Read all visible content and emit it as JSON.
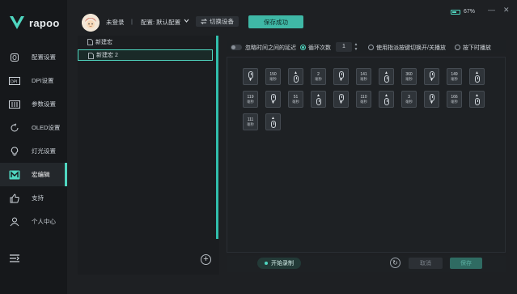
{
  "brand": {
    "logo_text": "rapoo",
    "accent": "#4fd6c0"
  },
  "sidebar": {
    "items": [
      {
        "label": "配置设置",
        "icon": "mouse-icon"
      },
      {
        "label": "DPI设置",
        "icon": "dpi-icon"
      },
      {
        "label": "参数设置",
        "icon": "sliders-icon"
      },
      {
        "label": "OLED设置",
        "icon": "oled-icon"
      },
      {
        "label": "灯光设置",
        "icon": "bulb-icon"
      },
      {
        "label": "宏编辑",
        "icon": "macro-icon",
        "active": true
      },
      {
        "label": "支持",
        "icon": "thumbs-up-icon"
      },
      {
        "label": "个人中心",
        "icon": "person-icon"
      }
    ]
  },
  "header": {
    "login_status": "未登录",
    "separator": "|",
    "profile_label": "配置: 默认配置",
    "switch_device": "切换设备",
    "save_status": "保存成功"
  },
  "battery": {
    "percent_text": "67%",
    "level": 0.67
  },
  "window_controls": {
    "minimize": "—",
    "close": "✕"
  },
  "macro_list": {
    "items": [
      {
        "label": "新建宏",
        "active": false
      },
      {
        "label": "新建宏 2",
        "active": true
      }
    ]
  },
  "editor": {
    "ignore_delay_label": "忽略时间之间的延迟",
    "loop_label": "循环次数",
    "loop_value": "1",
    "toggle_play_label": "使用指派按键切换开/关播放",
    "hold_play_label": "按下时播放",
    "selected_mode": "loop",
    "tiles": [
      {
        "kind": "mouse",
        "dir": "down"
      },
      {
        "kind": "delay",
        "value": "150",
        "unit": "毫秒"
      },
      {
        "kind": "mouse",
        "dir": "up"
      },
      {
        "kind": "delay",
        "value": "2",
        "unit": "毫秒"
      },
      {
        "kind": "mouse",
        "dir": "down"
      },
      {
        "kind": "delay",
        "value": "141",
        "unit": "毫秒"
      },
      {
        "kind": "mouse",
        "dir": "up"
      },
      {
        "kind": "delay",
        "value": "360",
        "unit": "毫秒"
      },
      {
        "kind": "mouse",
        "dir": "down"
      },
      {
        "kind": "delay",
        "value": "149",
        "unit": "毫秒"
      },
      {
        "kind": "mouse",
        "dir": "up"
      },
      {
        "kind": "delay",
        "value": "119",
        "unit": "毫秒"
      },
      {
        "kind": "mouse",
        "dir": "down"
      },
      {
        "kind": "delay",
        "value": "51",
        "unit": "毫秒"
      },
      {
        "kind": "mouse",
        "dir": "up"
      },
      {
        "kind": "mouse",
        "dir": "down"
      },
      {
        "kind": "delay",
        "value": "110",
        "unit": "毫秒"
      },
      {
        "kind": "mouse",
        "dir": "up"
      },
      {
        "kind": "delay",
        "value": "3",
        "unit": "毫秒"
      },
      {
        "kind": "mouse",
        "dir": "down"
      },
      {
        "kind": "delay",
        "value": "166",
        "unit": "毫秒"
      },
      {
        "kind": "mouse",
        "dir": "up"
      },
      {
        "kind": "delay",
        "value": "111",
        "unit": "毫秒"
      },
      {
        "kind": "mouse",
        "dir": "up"
      }
    ]
  },
  "footer": {
    "record_label": "开始录制",
    "cancel_label": "取消",
    "save_label": "保存"
  }
}
